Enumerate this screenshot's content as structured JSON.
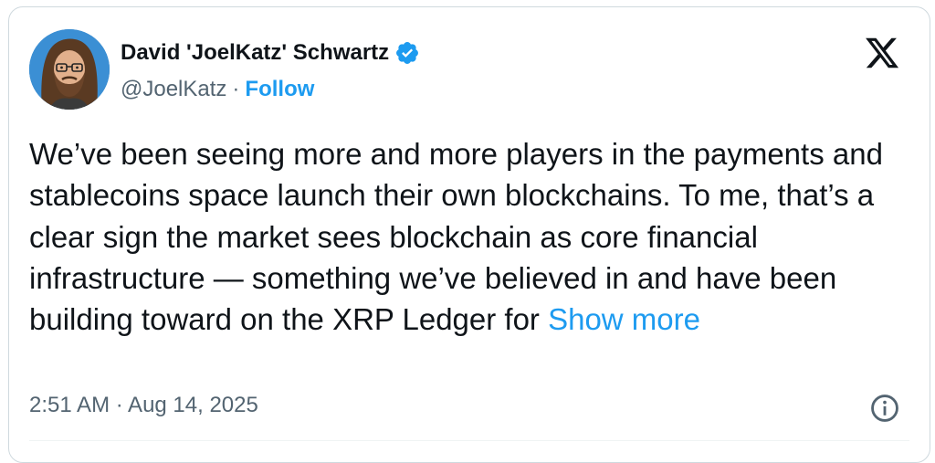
{
  "author": {
    "name": "David 'JoelKatz' Schwartz",
    "handle": "@JoelKatz",
    "separator": "·",
    "follow_label": "Follow"
  },
  "tweet": {
    "text": "We’ve been seeing more and more players in the payments and stablecoins space launch their own blockchains. To me, that’s a clear sign the market sees blockchain as core financial infrastructure — something we’ve believed in and have been building toward on the XRP Ledger for",
    "show_more_label": "Show more",
    "timestamp": "2:51 AM · Aug 14, 2025"
  },
  "icons": {
    "verified": "verified-badge-icon",
    "logo": "x-logo-icon",
    "info": "info-icon"
  },
  "colors": {
    "text": "#0f1419",
    "secondary": "#536471",
    "accent": "#1d9bf0",
    "border": "#cfd9de"
  }
}
